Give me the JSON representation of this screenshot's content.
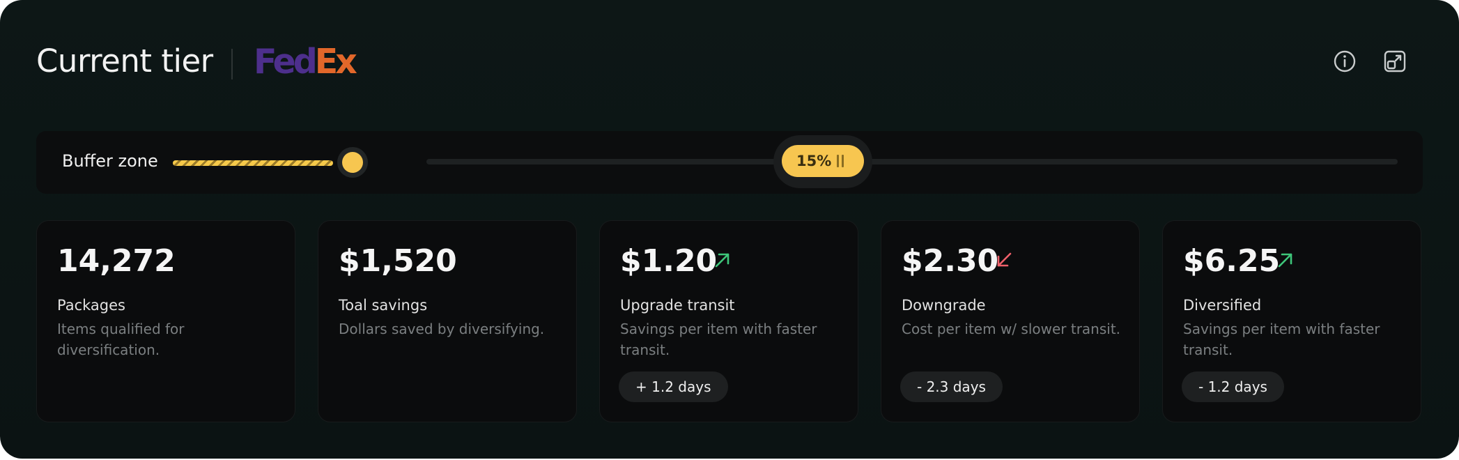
{
  "header": {
    "title": "Current tier",
    "logo": {
      "part1": "Fed",
      "part2": "Ex",
      "color1": "#4d2f8c",
      "color2": "#e2672a"
    },
    "icons": [
      "info-icon",
      "expand-window-icon"
    ]
  },
  "slider": {
    "buffer_label": "Buffer zone",
    "percent": "15%",
    "accent": "#f7c650"
  },
  "cards": [
    {
      "value": "14,272",
      "label": "Packages",
      "desc": "Items qualified for diversification."
    },
    {
      "value": "$1,520",
      "label": "Toal savings",
      "desc": "Dollars saved by diversifying."
    },
    {
      "value": "$1.20",
      "label": "Upgrade transit",
      "desc": "Savings per item with faster transit.",
      "days": "+ 1.2 days",
      "trend": "up",
      "trend_color": "#3ec77a"
    },
    {
      "value": "$2.30",
      "label": "Downgrade",
      "desc": "Cost per item w/ slower transit.",
      "days": "- 2.3 days",
      "trend": "down",
      "trend_color": "#f0606a"
    },
    {
      "value": "$6.25",
      "label": "Diversified",
      "desc": "Savings per item with faster transit.",
      "days": "- 1.2 days",
      "trend": "up",
      "trend_color": "#3ec77a"
    }
  ]
}
